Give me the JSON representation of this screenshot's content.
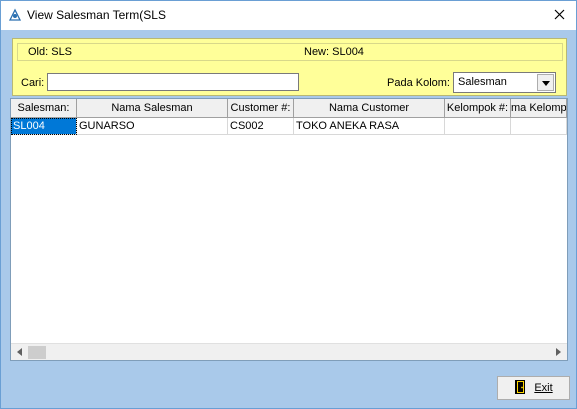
{
  "window": {
    "title": "View Salesman Term(SLS"
  },
  "info": {
    "old_text": "Old: SLS",
    "new_text": "New: SL004"
  },
  "search": {
    "label": "Cari:",
    "value": "",
    "placeholder": ""
  },
  "column_filter": {
    "label": "Pada Kolom:",
    "selected": "Salesman"
  },
  "grid": {
    "columns": [
      "Salesman:",
      "Nama Salesman",
      "Customer #:",
      "Nama Customer",
      "Kelompok #:",
      "ma Kelomp"
    ],
    "rows": [
      [
        "SL004",
        "GUNARSO",
        "CS002",
        "TOKO ANEKA RASA",
        "",
        ""
      ]
    ]
  },
  "buttons": {
    "exit_label": "Exit"
  },
  "colors": {
    "panel_background": "#ffff99",
    "window_background": "#a9c9ea",
    "selection": "#0078d7"
  },
  "icons": {
    "app": "app-icon",
    "close": "close-icon",
    "dropdown": "chevron-down-icon",
    "exit": "exit-door-icon",
    "scroll_left": "arrow-left-icon",
    "scroll_right": "arrow-right-icon"
  }
}
